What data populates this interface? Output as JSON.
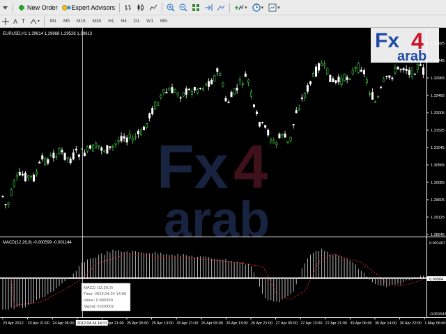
{
  "toolbar": {
    "new_order": "New Order",
    "expert_advisors": "Expert Advisors",
    "timeframes": [
      "M1",
      "M5",
      "M15",
      "M30",
      "H1",
      "H4",
      "D1",
      "W1",
      "MN"
    ]
  },
  "main_chart": {
    "header": "EURUSD,H1  1.29614 1.29668 1.29526 1.29613",
    "price_labels": [
      "1.33925",
      "1.33445",
      "1.32965",
      "1.32485",
      "1.32005",
      "1.31525",
      "1.31045",
      "1.30565",
      "1.30085",
      "1.29605",
      "1.29125",
      "1.28645"
    ]
  },
  "macd": {
    "header": "MACD(12,26,9) -0.000599 -0.001144",
    "scale_labels": [
      "0.001407",
      "0.00004",
      "-0.001543"
    ],
    "tooltip": [
      "MACD (12,26,9)",
      "Time: 2012.04.24 14:00",
      "Value: 0.000269",
      "Signal: 0.000002"
    ]
  },
  "time_axis": [
    "23 Apr 2012",
    "23 Apr 21:00",
    "24 Apr 05:00",
    "2012.04.24 14:00",
    "24 Apr 21:00",
    "25 Apr 05:00",
    "25 Apr 13:00",
    "25 Apr 21:00",
    "26 Apr 05:00",
    "26 Apr 13:00",
    "26 Apr 21:00",
    "27 Apr 05:00",
    "27 Apr 13:00",
    "27 Apr 21:00",
    "30 Apr 06:00",
    "30 Apr 14:00",
    "30 Apr 22:00",
    "1 May 06:00"
  ],
  "watermark": "Fx4 arab",
  "colors": {
    "bull": "#3fcf3f",
    "bear": "#ffffff",
    "macd_hist": "#c8c8c8",
    "signal": "#d22020",
    "grid": "#ffffff"
  }
}
